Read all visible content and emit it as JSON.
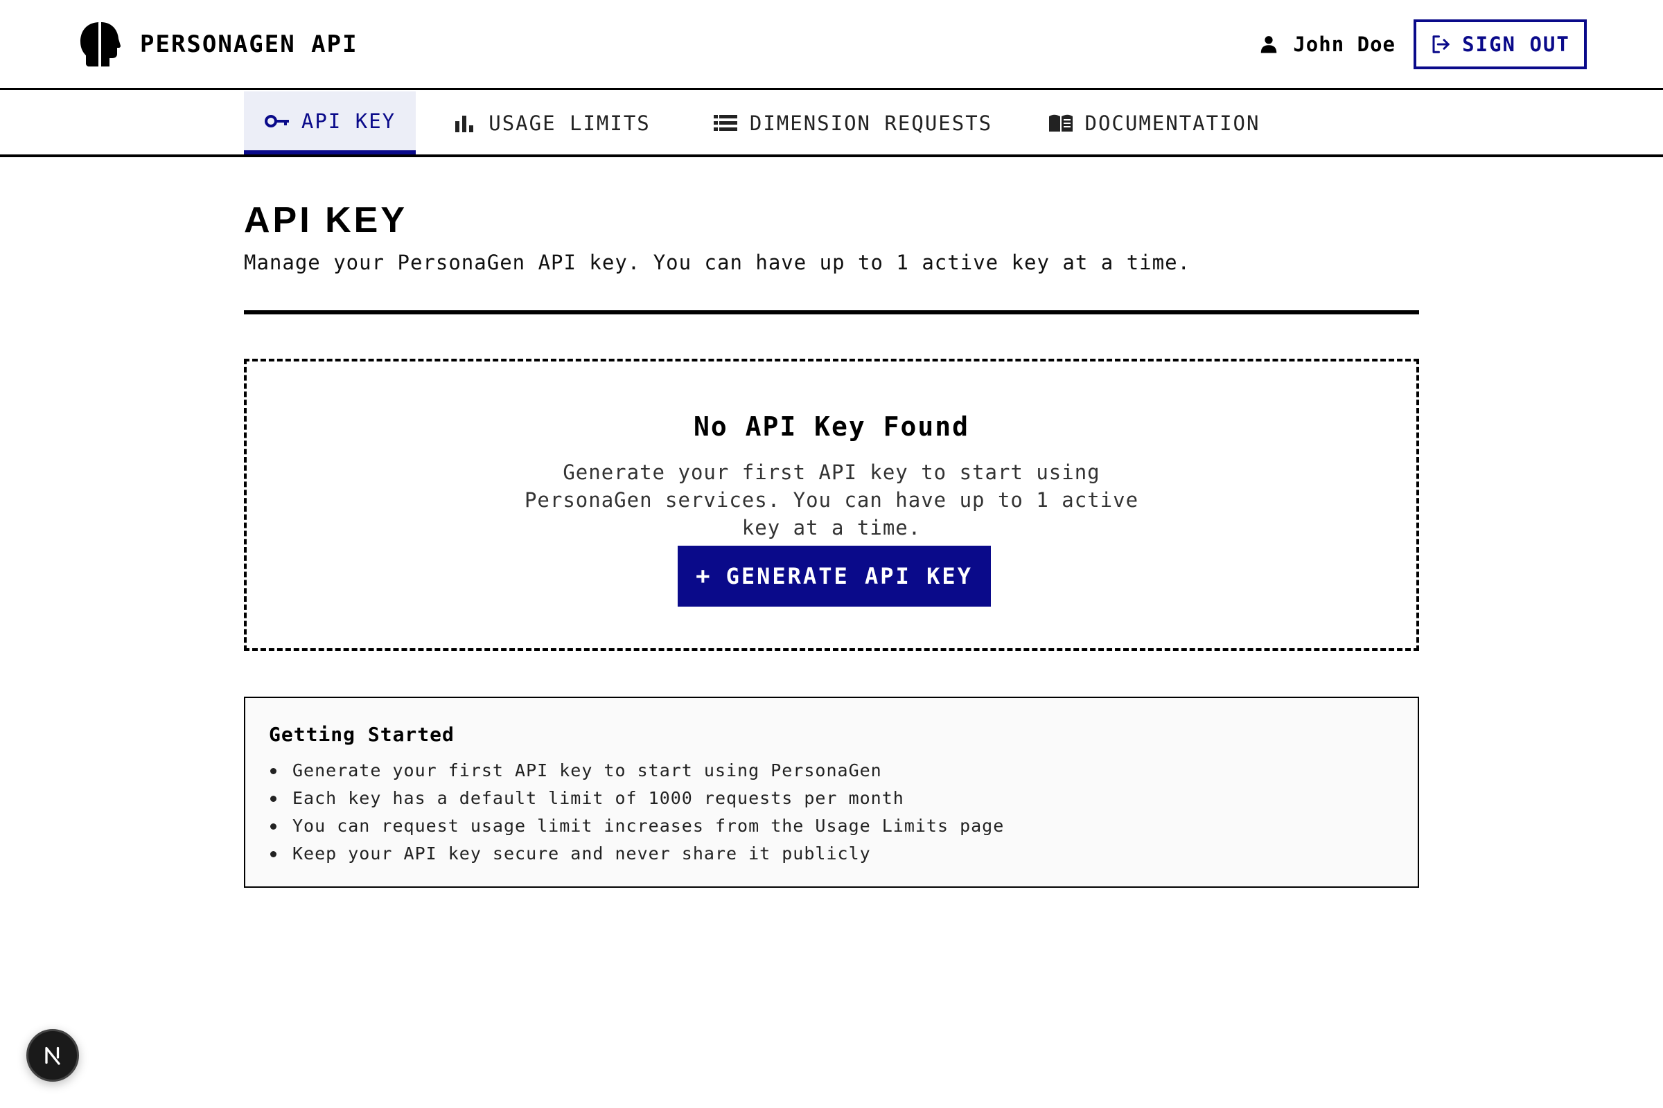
{
  "brand": {
    "title": "PERSONAGEN API",
    "logo_icon": "head-silhouette-icon"
  },
  "user": {
    "name": "John Doe",
    "icon": "person-icon"
  },
  "signout": {
    "label": "SIGN OUT",
    "icon": "sign-out-icon"
  },
  "nav": {
    "tabs": [
      {
        "label": "API KEY",
        "icon": "key-icon",
        "active": true
      },
      {
        "label": "USAGE LIMITS",
        "icon": "bar-chart-icon",
        "active": false
      },
      {
        "label": "DIMENSION REQUESTS",
        "icon": "list-icon",
        "active": false
      },
      {
        "label": "DOCUMENTATION",
        "icon": "book-icon",
        "active": false
      }
    ]
  },
  "page": {
    "heading": "API KEY",
    "description": "Manage your PersonaGen API key. You can have up to 1 active key at a time."
  },
  "empty_state": {
    "title": "No API Key Found",
    "text": "Generate your first API key to start using PersonaGen services. You can have up to 1 active key at a time.",
    "button_label": "GENERATE API KEY",
    "button_icon": "plus-icon"
  },
  "getting_started": {
    "title": "Getting Started",
    "items": [
      "Generate your first API key to start using PersonaGen",
      "Each key has a default limit of 1000 requests per month",
      "You can request usage limit increases from the Usage Limits page",
      "Keep your API key secure and never share it publicly"
    ]
  },
  "dev_badge": {
    "letter": "N",
    "icon": "nextjs-icon"
  },
  "colors": {
    "accent": "#0a0a8a",
    "active_tab_bg": "#eceef7",
    "info_bg": "#fafafa"
  }
}
